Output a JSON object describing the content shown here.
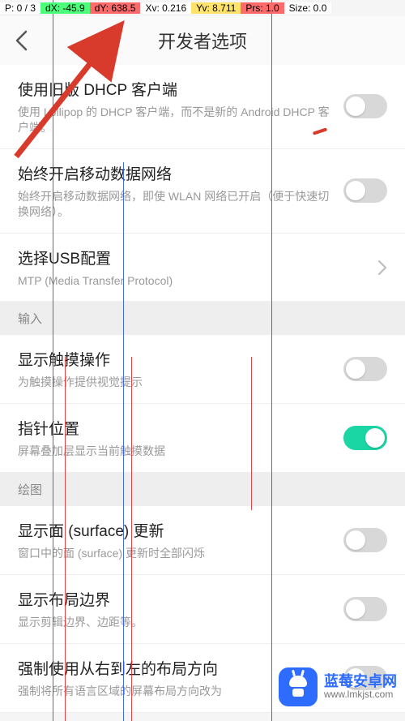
{
  "debug": {
    "p": "P: 0 / 3",
    "dx": "dX: -45.9",
    "dy": "dY: 638.5",
    "xv": "Xv: 0.216",
    "yv": "Yv: 8.711",
    "prs": "Prs: 1.0",
    "size": "Size: 0.0"
  },
  "header": {
    "title": "开发者选项"
  },
  "sections": {
    "net": [
      {
        "title": "使用旧版 DHCP 客户端",
        "sub": "使用 Lollipop 的 DHCP 客户端，而不是新的 Android DHCP 客户端。",
        "on": false
      },
      {
        "title": "始终开启移动数据网络",
        "sub": "始终开启移动数据网络，即使 WLAN 网络已开启（便于快速切换网络）。",
        "on": false
      },
      {
        "title": "选择USB配置",
        "sub": "MTP (Media Transfer Protocol)"
      }
    ],
    "input_header": "输入",
    "input": [
      {
        "title": "显示触摸操作",
        "sub": "为触摸操作提供视觉提示",
        "on": false
      },
      {
        "title": "指针位置",
        "sub": "屏幕叠加层显示当前触摸数据",
        "on": true
      }
    ],
    "draw_header": "绘图",
    "draw": [
      {
        "title": "显示面 (surface) 更新",
        "sub": "窗口中的面 (surface) 更新时全部闪烁",
        "on": false
      },
      {
        "title": "显示布局边界",
        "sub": "显示剪辑边界、边距等。",
        "on": false
      },
      {
        "title": "强制使用从右到左的布局方向",
        "sub": "强制将所有语言区域的屏幕布局方向改为",
        "on": false
      }
    ]
  },
  "watermark": {
    "name": "蓝莓安卓网",
    "url": "www.lmkjst.com"
  }
}
